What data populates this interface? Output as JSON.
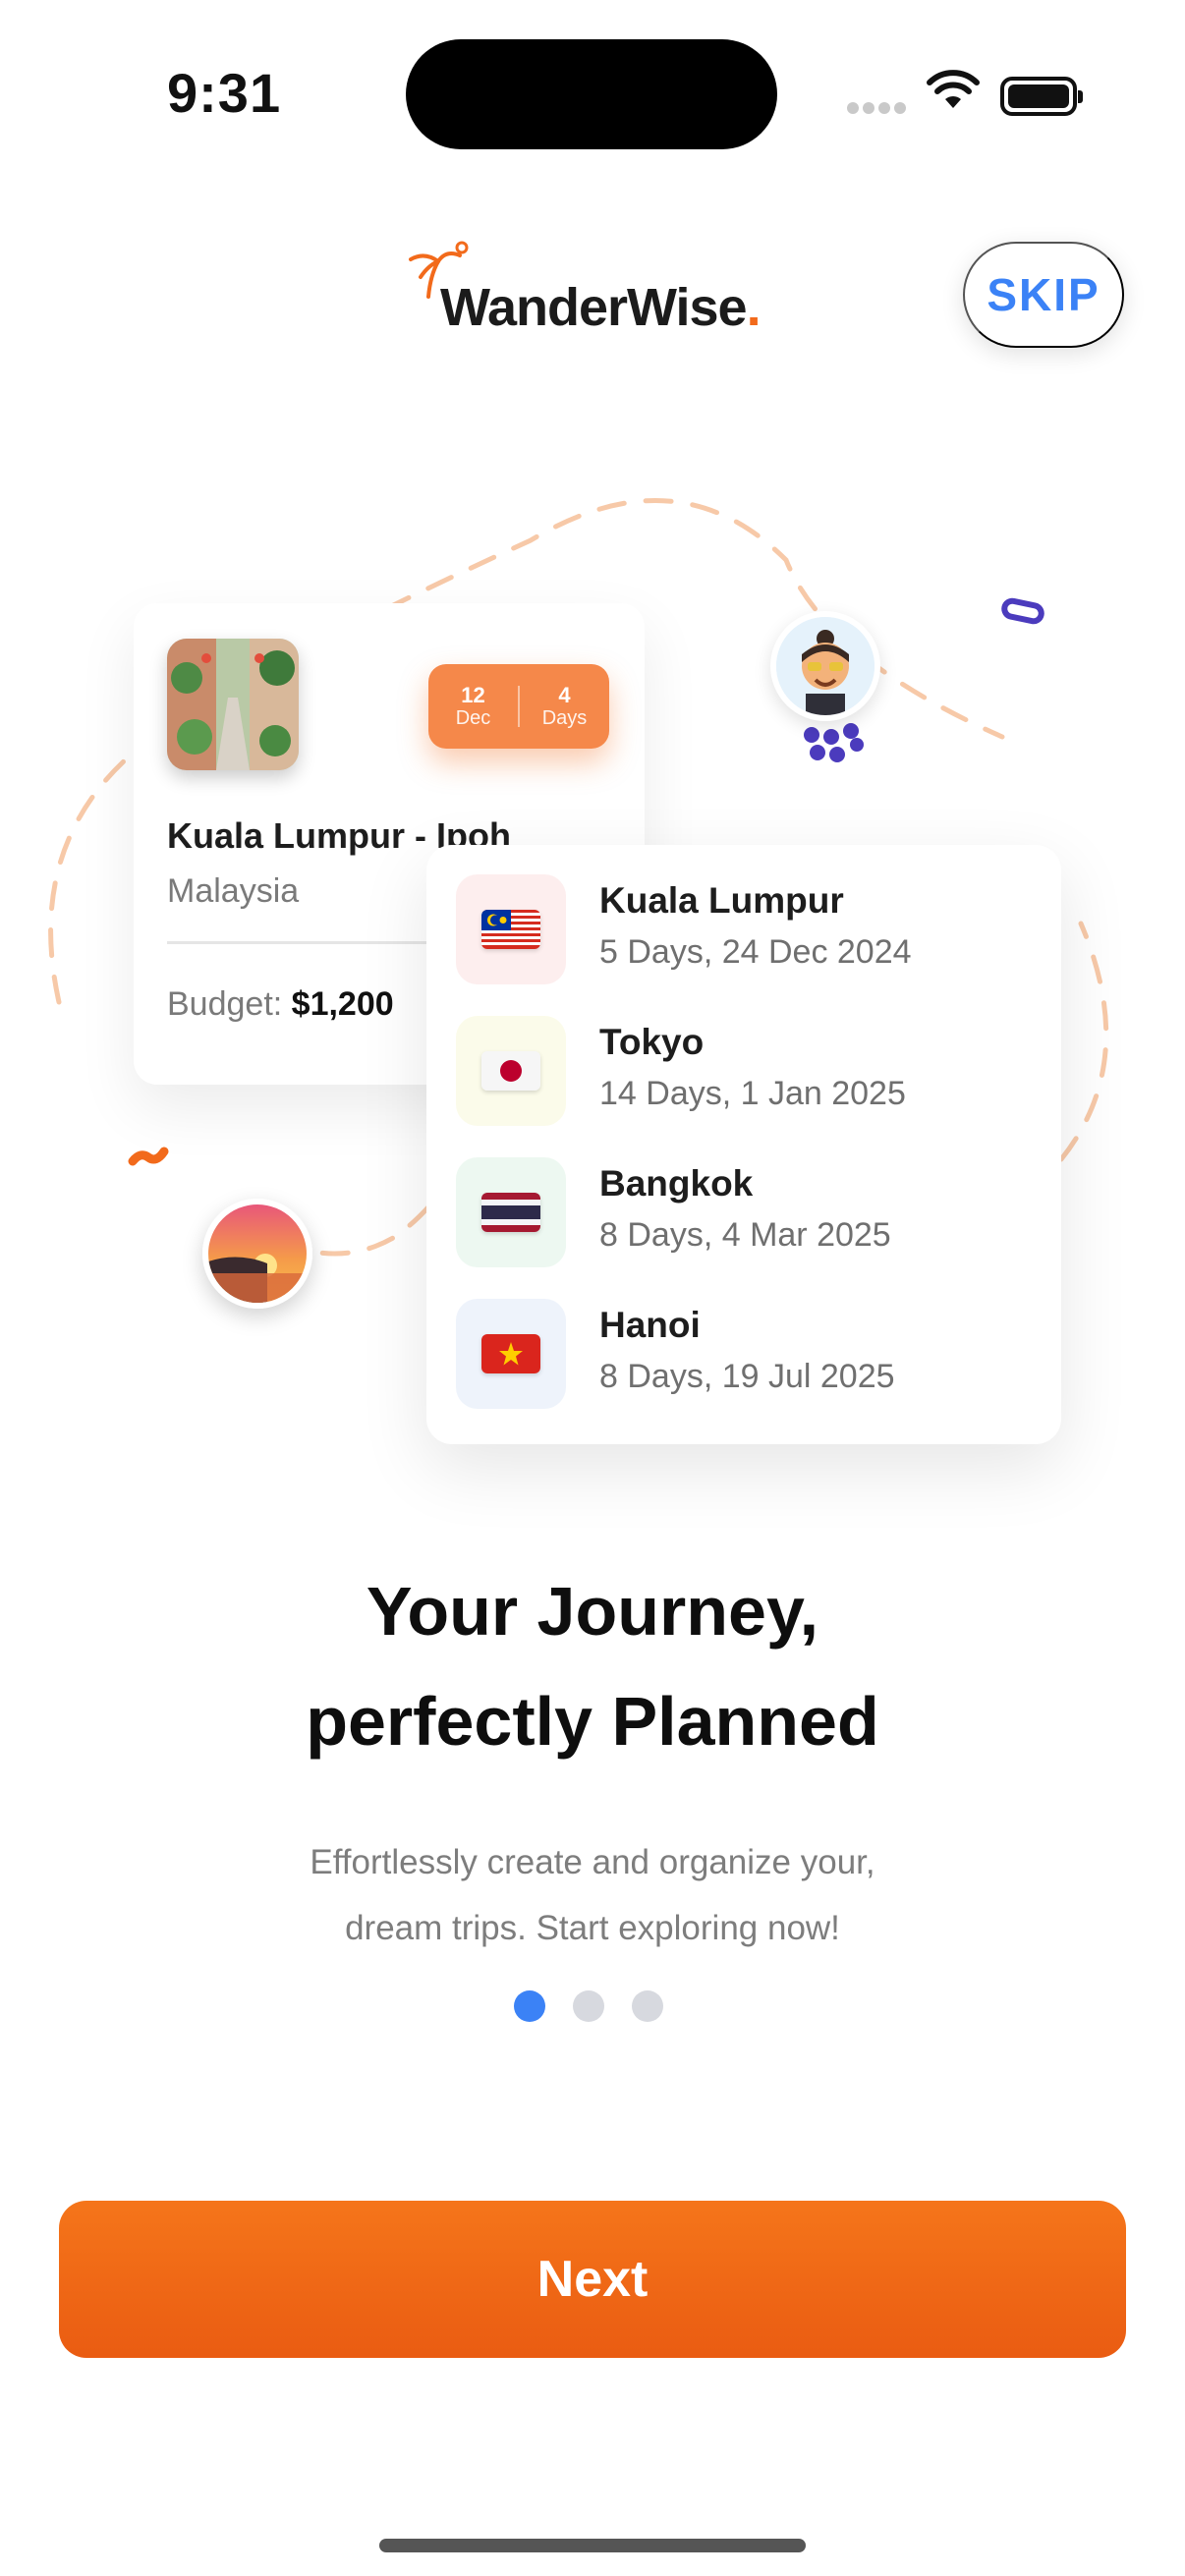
{
  "status_bar": {
    "time": "9:31"
  },
  "header": {
    "brand_name": "WanderWise",
    "brand_dot": ".",
    "skip_label": "SKIP",
    "brand_color": "#f26a1b"
  },
  "trip_card": {
    "date_day": "12",
    "date_month": "Dec",
    "duration_value": "4",
    "duration_unit": "Days",
    "title": "Kuala Lumpur - Ipoh",
    "country": "Malaysia",
    "budget_label": "Budget:",
    "budget_value": "$1,200"
  },
  "destinations": [
    {
      "name": "Kuala Lumpur",
      "detail": "5 Days, 24 Dec 2024",
      "flag": "malaysia-flag-icon"
    },
    {
      "name": "Tokyo",
      "detail": "14 Days, 1 Jan 2025",
      "flag": "japan-flag-icon"
    },
    {
      "name": "Bangkok",
      "detail": "8 Days, 4 Mar 2025",
      "flag": "thailand-flag-icon"
    },
    {
      "name": "Hanoi",
      "detail": "8 Days, 19 Jul 2025",
      "flag": "vietnam-flag-icon"
    }
  ],
  "onboarding": {
    "headline_line1": "Your Journey,",
    "headline_line2": "perfectly Planned",
    "description_line1": "Effortlessly create and organize your,",
    "description_line2": "dream trips. Start exploring now!",
    "page_count": 3,
    "current_page": 1
  },
  "cta": {
    "next_label": "Next",
    "accent": "#3b82f6"
  }
}
